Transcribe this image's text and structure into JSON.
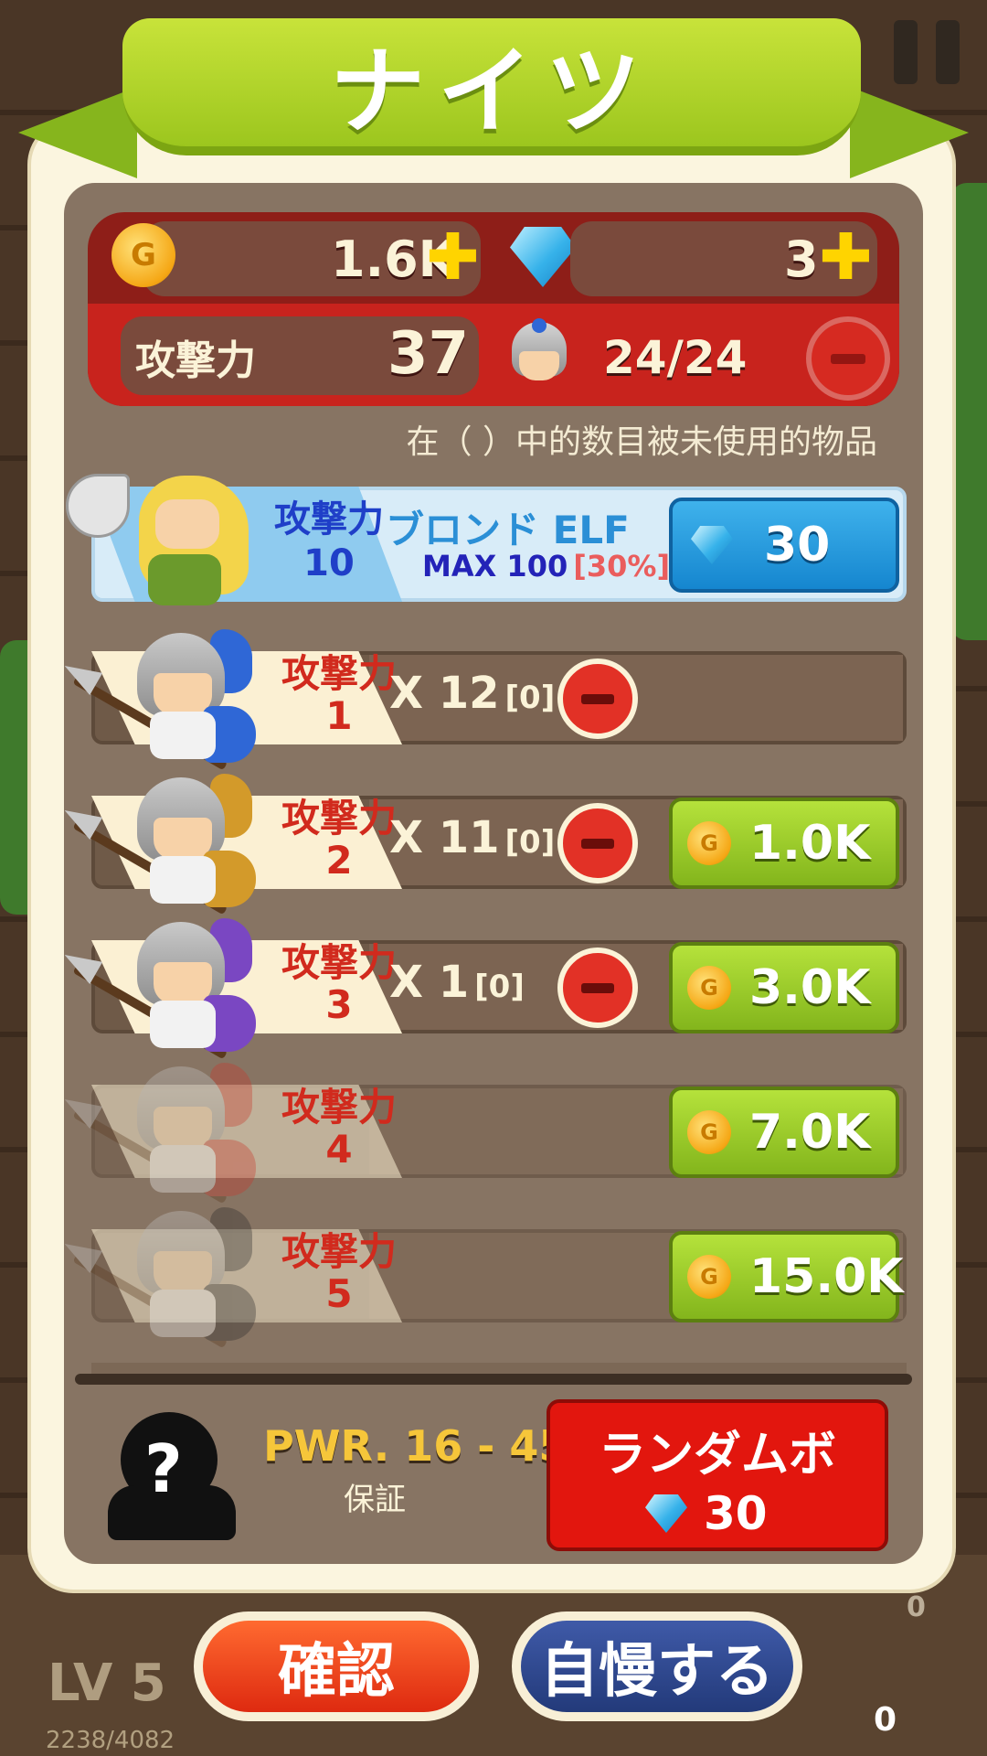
{
  "title": "ナイツ",
  "resources": {
    "gold": "1.6K",
    "gems": "3",
    "plus": "✚"
  },
  "stats": {
    "attack_label": "攻撃力",
    "attack_value": "37",
    "knights": "24/24"
  },
  "note": "在（ ）中的数目被未使用的物品",
  "coin_symbol": "G",
  "elf": {
    "attack_label": "攻撃力",
    "attack_value": "10",
    "name": "ブロンド ELF",
    "max": "MAX 100",
    "pct": "[30%]",
    "price": "30"
  },
  "knights": [
    {
      "attack_label": "攻撃力",
      "attack_value": "1",
      "count": "X 12",
      "unused": "[0]",
      "price": "",
      "plume": "#2f67d6"
    },
    {
      "attack_label": "攻撃力",
      "attack_value": "2",
      "count": "X 11",
      "unused": "[0]",
      "price": "1.0K",
      "plume": "#d39a2a"
    },
    {
      "attack_label": "攻撃力",
      "attack_value": "3",
      "count": "X 1",
      "unused": "[0]",
      "price": "3.0K",
      "plume": "#7a47c2"
    },
    {
      "attack_label": "攻撃力",
      "attack_value": "4",
      "count": "",
      "unused": "",
      "price": "7.0K",
      "plume": "#c9372b"
    },
    {
      "attack_label": "攻撃力",
      "attack_value": "5",
      "count": "",
      "unused": "",
      "price": "15.0K",
      "plume": "#2a2a2a"
    }
  ],
  "random": {
    "pwr": "PWR. 16 - 45",
    "guarantee": "保証",
    "button_label": "ランダムボ",
    "price": "30",
    "mystery": "?"
  },
  "buttons": {
    "confirm": "確認",
    "brag": "自慢する"
  },
  "background": {
    "level": "LV 5",
    "xp": "2238/4082",
    "zero_top": "0",
    "zero_bottom": "0"
  }
}
